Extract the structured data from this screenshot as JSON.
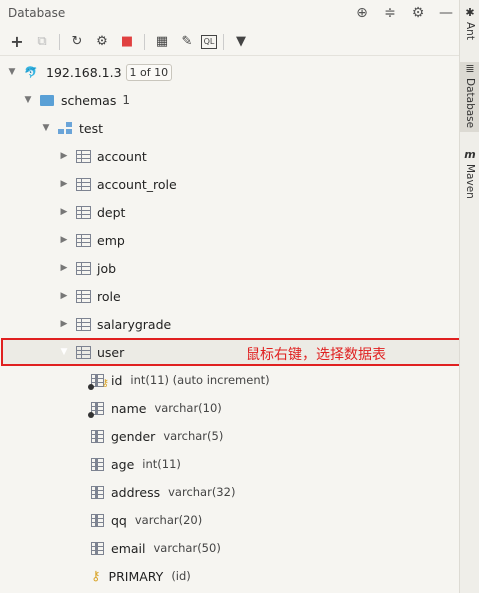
{
  "panel": {
    "title": "Database",
    "title_icons": [
      "crosshair-icon",
      "collapse-icon",
      "gear-icon",
      "minimize-icon"
    ]
  },
  "toolbar": {
    "buttons": [
      {
        "name": "add-icon",
        "glyph": "+"
      },
      {
        "name": "duplicate-icon",
        "glyph": "⧉"
      },
      {
        "name": "refresh-icon",
        "glyph": "↻"
      },
      {
        "name": "properties-icon",
        "glyph": "⚙"
      },
      {
        "name": "stop-icon",
        "glyph": "■"
      },
      {
        "name": "table-view-icon",
        "glyph": "▦"
      },
      {
        "name": "edit-icon",
        "glyph": "✎"
      },
      {
        "name": "console-icon",
        "glyph": "QL"
      },
      {
        "name": "filter-icon",
        "glyph": "▼"
      }
    ]
  },
  "tree": {
    "host": {
      "label": "192.168.1.3",
      "counter": "1 of 10"
    },
    "schemas": {
      "label": "schemas",
      "count": "1"
    },
    "schema": {
      "label": "test"
    },
    "tables": [
      "account",
      "account_role",
      "dept",
      "emp",
      "job",
      "role",
      "salarygrade"
    ],
    "selected_table": "user",
    "columns": [
      {
        "name": "id",
        "type": "int(11) (auto increment)",
        "kind": "pk"
      },
      {
        "name": "name",
        "type": "varchar(10)",
        "kind": "notnull"
      },
      {
        "name": "gender",
        "type": "varchar(5)",
        "kind": "plain"
      },
      {
        "name": "age",
        "type": "int(11)",
        "kind": "plain"
      },
      {
        "name": "address",
        "type": "varchar(32)",
        "kind": "plain"
      },
      {
        "name": "qq",
        "type": "varchar(20)",
        "kind": "plain"
      },
      {
        "name": "email",
        "type": "varchar(50)",
        "kind": "plain"
      }
    ],
    "primary": {
      "label": "PRIMARY",
      "cols": "(id)"
    }
  },
  "annotation": "鼠标右键，选择数据表",
  "highlight_color": "#e02020",
  "rightbar": {
    "tabs": [
      {
        "label": "Ant",
        "icon": "ant-icon"
      },
      {
        "label": "Database",
        "icon": "database-icon"
      },
      {
        "label": "Maven",
        "icon": "maven-icon"
      }
    ]
  }
}
